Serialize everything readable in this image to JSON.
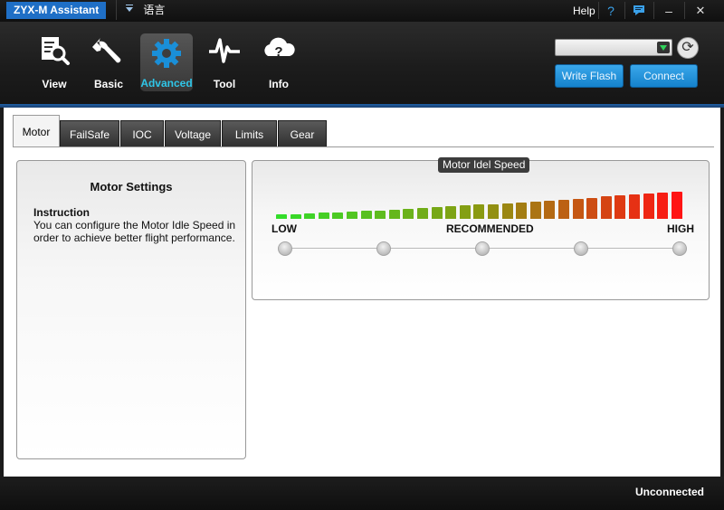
{
  "window": {
    "title": "ZYX-M Assistant",
    "language_label": "语言",
    "help_label": "Help",
    "help_icon": "?",
    "chat_icon": "chat-bubble-icon",
    "minimize_icon": "–",
    "close_icon": "✕"
  },
  "nav": [
    {
      "id": "view",
      "label": "View",
      "icon": "magnifier-document-icon"
    },
    {
      "id": "basic",
      "label": "Basic",
      "icon": "wrench-icon"
    },
    {
      "id": "advanced",
      "label": "Advanced",
      "icon": "gear-icon",
      "active": true
    },
    {
      "id": "tool",
      "label": "Tool",
      "icon": "pulse-icon"
    },
    {
      "id": "info",
      "label": "Info",
      "icon": "question-cloud-icon"
    }
  ],
  "connection": {
    "port_value": "",
    "refresh_icon": "⟳",
    "write_flash_label": "Write Flash",
    "connect_label": "Connect"
  },
  "tabs": [
    {
      "id": "motor",
      "label": "Motor",
      "active": true
    },
    {
      "id": "failsafe",
      "label": "FailSafe"
    },
    {
      "id": "ioc",
      "label": "IOC"
    },
    {
      "id": "voltage",
      "label": "Voltage"
    },
    {
      "id": "limits",
      "label": "Limits"
    },
    {
      "id": "gear",
      "label": "Gear"
    }
  ],
  "motor_settings": {
    "title": "Motor Settings",
    "instruction_title": "Instruction",
    "instruction_text": "You can configure the Motor Idle Speed in order to achieve better flight performance."
  },
  "idle_speed": {
    "group_title": "Motor Idel Speed",
    "low_label": "LOW",
    "recommended_label": "RECOMMENDED",
    "high_label": "HIGH",
    "levels": 5,
    "selected_level": null,
    "colors": {
      "low": "#33dd2a",
      "mid": "#8a9a12",
      "high": "#ff1414"
    }
  },
  "status": {
    "text": "Unconnected"
  }
}
